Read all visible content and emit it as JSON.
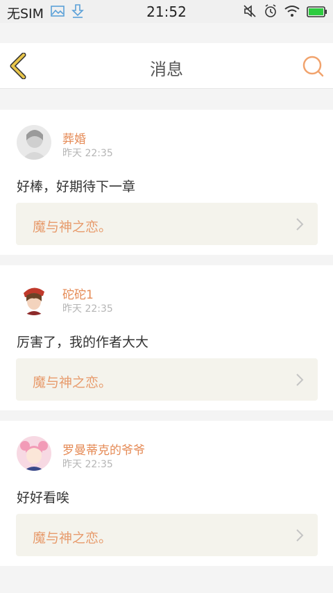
{
  "status_bar": {
    "carrier": "无SIM",
    "time": "21:52"
  },
  "header": {
    "title": "消息"
  },
  "messages": [
    {
      "name": "葬婚",
      "time": "昨天 22:35",
      "content": "好棒，好期待下一章",
      "work_title": "魔与神之恋。"
    },
    {
      "name": "砣砣1",
      "time": "昨天 22:35",
      "content": "厉害了，我的作者大大",
      "work_title": "魔与神之恋。"
    },
    {
      "name": "罗曼蒂克的爷爷",
      "time": "昨天 22:35",
      "content": "好好看唉",
      "work_title": "魔与神之恋。"
    }
  ],
  "colors": {
    "accent": "#e58a55",
    "back_arrow": "#e8c54a",
    "search": "#f1a36d"
  },
  "icons": [
    "image-icon",
    "download-icon",
    "mute-icon",
    "alarm-icon",
    "wifi-icon",
    "battery-icon",
    "back-arrow-icon",
    "search-icon",
    "chevron-right-icon"
  ]
}
